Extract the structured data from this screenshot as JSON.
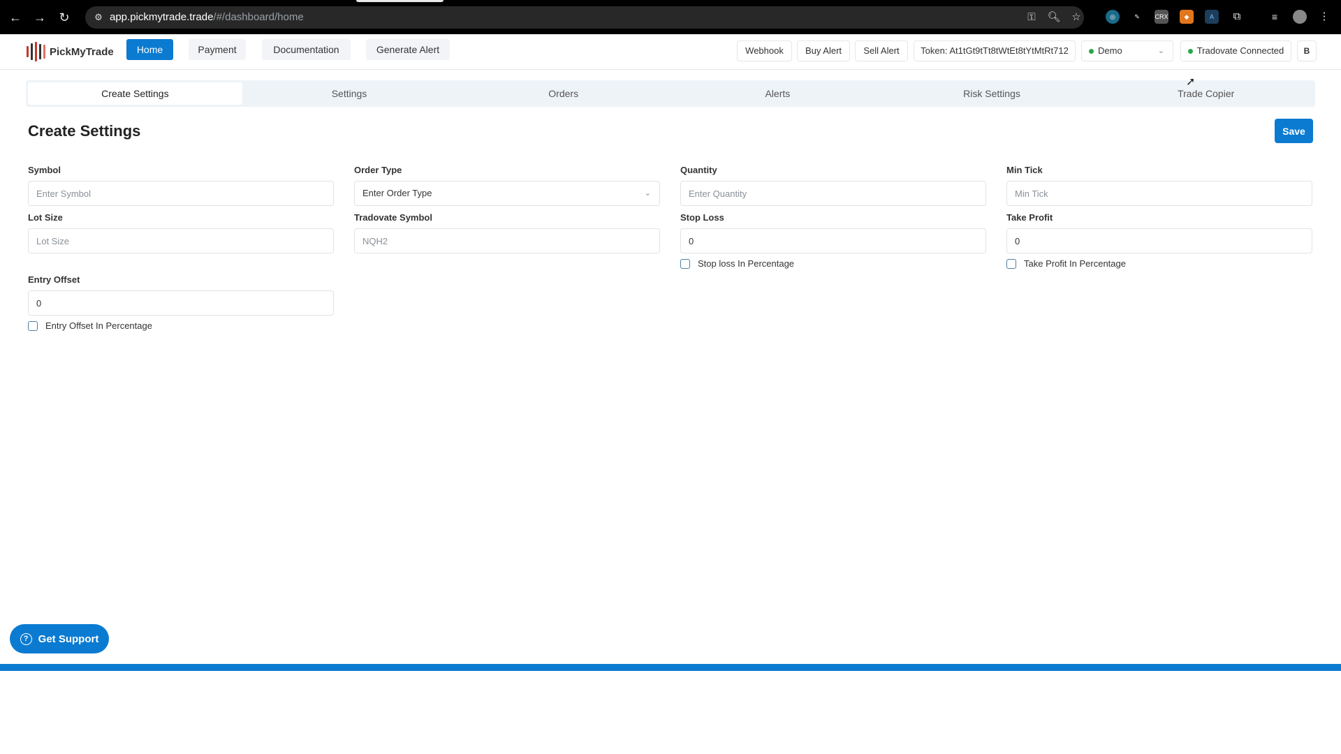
{
  "browser": {
    "url_host": "app.pickmytrade.trade",
    "url_path": "/#/dashboard/home",
    "back_icon": "←",
    "forward_icon": "→",
    "reload_icon": "↻",
    "extensions": [
      "web-extension",
      "broom-extension",
      "CRX",
      "fox-extension",
      "compass-extension",
      "puzzle-extension"
    ],
    "crx_label": "CRX"
  },
  "header": {
    "brand": "PickMyTrade",
    "nav": [
      {
        "label": "Home",
        "active": true
      },
      {
        "label": "Payment"
      },
      {
        "label": "Documentation"
      },
      {
        "label": "Generate Alert"
      }
    ],
    "webhook_label": "Webhook",
    "buy_alert_label": "Buy Alert",
    "sell_alert_label": "Sell Alert",
    "token_label": "Token: At1tGt9tTt8tWtEt8tYtMtRt712",
    "account_select": "Demo",
    "connection_status": "Tradovate Connected",
    "user_initial": "B",
    "status_color": "#28a745",
    "accent_color": "#0b7bd1"
  },
  "tabs": [
    {
      "label": "Create Settings",
      "active": true
    },
    {
      "label": "Settings"
    },
    {
      "label": "Orders"
    },
    {
      "label": "Alerts"
    },
    {
      "label": "Risk Settings"
    },
    {
      "label": "Trade Copier"
    }
  ],
  "form": {
    "title": "Create Settings",
    "save_label": "Save",
    "symbol": {
      "label": "Symbol",
      "placeholder": "Enter Symbol",
      "value": ""
    },
    "order_type": {
      "label": "Order Type",
      "selected": "Enter Order Type"
    },
    "quantity": {
      "label": "Quantity",
      "placeholder": "Enter Quantity",
      "value": ""
    },
    "min_tick": {
      "label": "Min Tick",
      "placeholder": "Min Tick",
      "value": ""
    },
    "lot_size": {
      "label": "Lot Size",
      "placeholder": "Lot Size",
      "value": ""
    },
    "tradovate_symbol": {
      "label": "Tradovate Symbol",
      "placeholder": "NQH2",
      "value": ""
    },
    "stop_loss": {
      "label": "Stop Loss",
      "value": "0",
      "checkbox_label": "Stop loss In Percentage",
      "checked": false
    },
    "take_profit": {
      "label": "Take Profit",
      "value": "0",
      "checkbox_label": "Take Profit In Percentage",
      "checked": false
    },
    "entry_offset": {
      "label": "Entry Offset",
      "value": "0",
      "checkbox_label": "Entry Offset In Percentage",
      "checked": false
    }
  },
  "support": {
    "label": "Get Support"
  }
}
